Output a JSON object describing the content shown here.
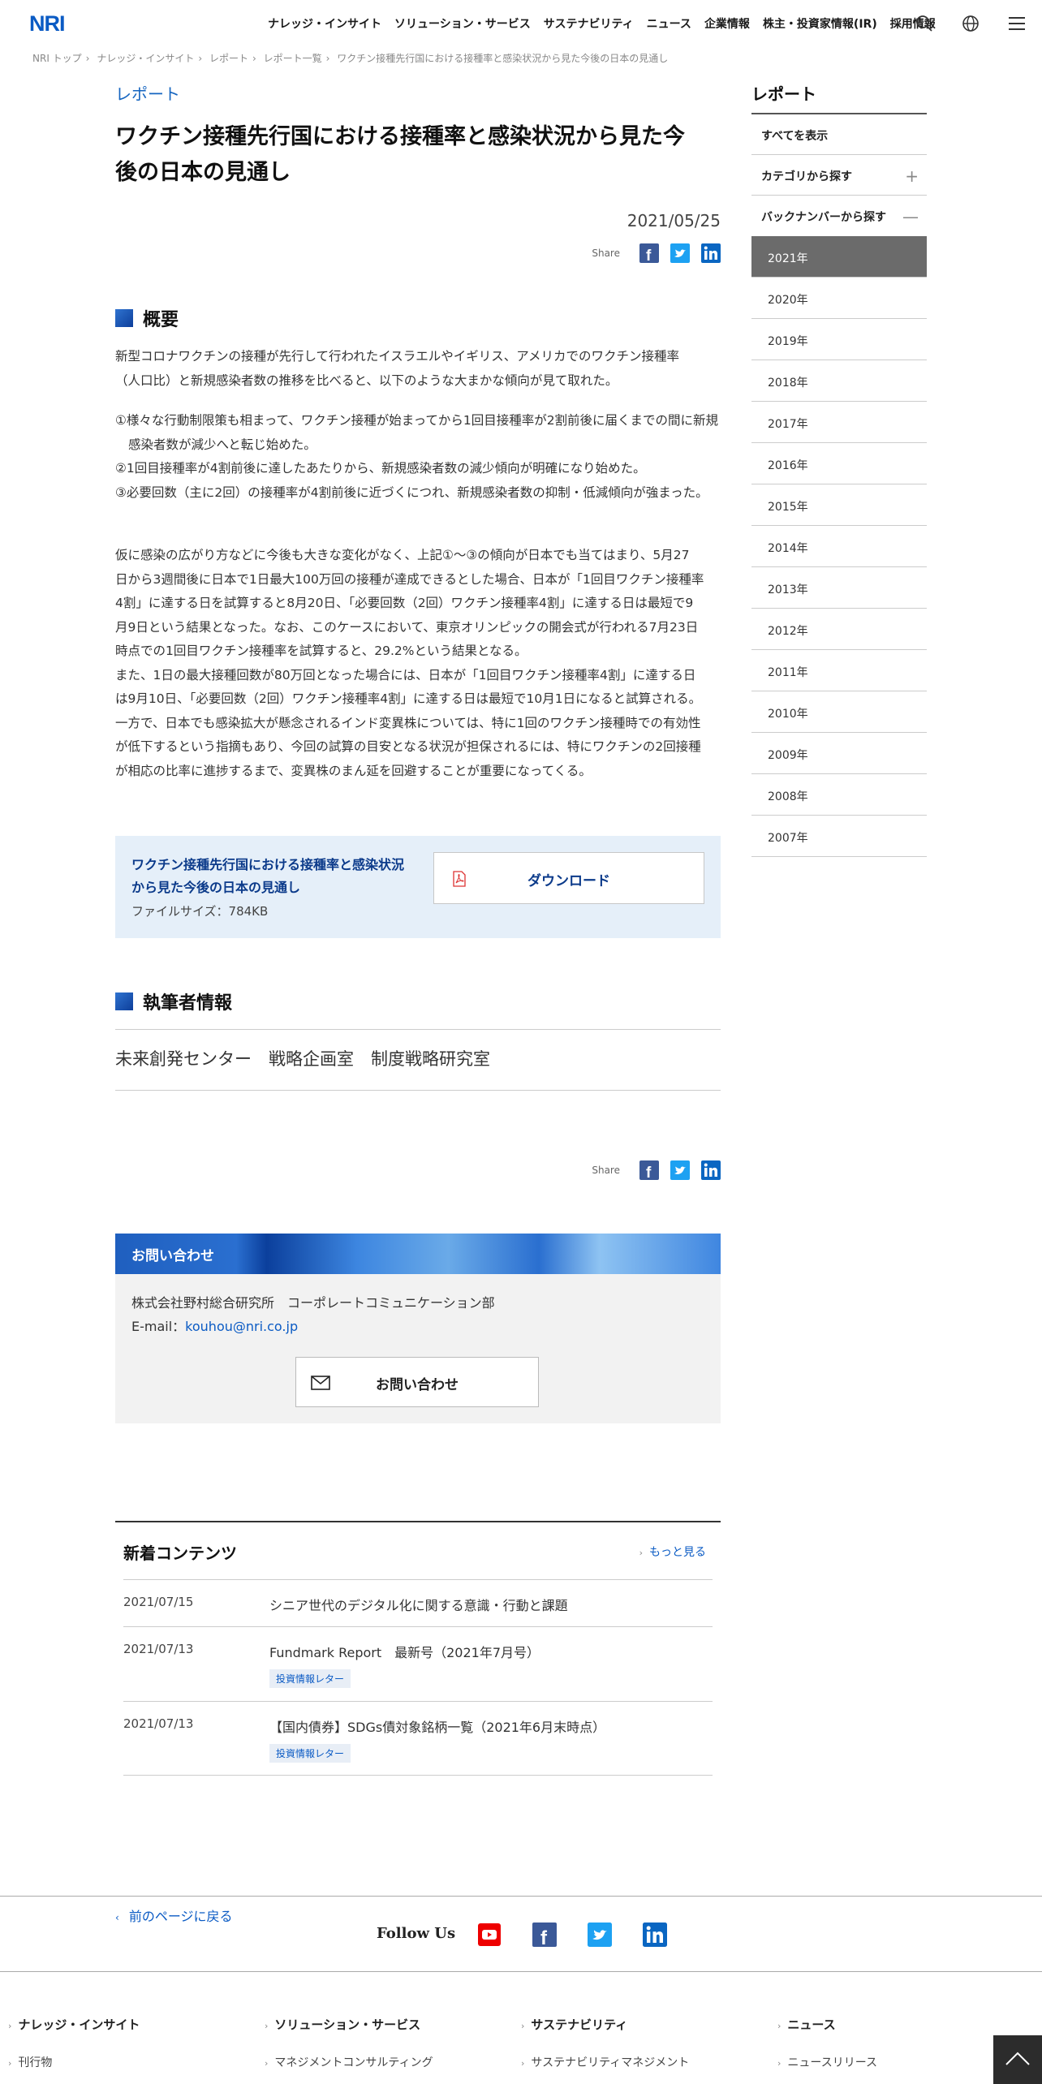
{
  "header": {
    "logo": "NRI",
    "nav": [
      "ナレッジ・インサイト",
      "ソリューション・サービス",
      "サステナビリティ",
      "ニュース",
      "企業情報",
      "株主・投資家情報(IR)",
      "採用情報"
    ]
  },
  "breadcrumb": [
    "NRI トップ",
    "ナレッジ・インサイト",
    "レポート",
    "レポート一覧",
    "ワクチン接種先行国における接種率と感染状況から見た今後の日本の見通し"
  ],
  "article": {
    "category": "レポート",
    "title_line1": "ワクチン接種先行国における接種率と感染状況から見た今",
    "title_line2": "後の日本の見通し",
    "date": "2021/05/25",
    "share_label": "Share",
    "overview_heading": "概要",
    "intro_line1": "新型コロナワクチンの接種が先行して行われたイスラエルやイギリス、アメリカでのワクチン接種率",
    "intro_line2": "（人口比）と新規感染者数の推移を比べると、以下のような大まかな傾向が見て取れた。",
    "points": [
      "①様々な行動制限策も相まって、ワクチン接種が始まってから1回目接種率が2割前後に届くまでの間に新規感染者数が減少へと転じ始めた。",
      "②1回目接種率が4割前後に達したあたりから、新規感染者数の減少傾向が明確になり始めた。",
      "③必要回数（主に2回）の接種率が4割前後に近づくにつれ、新規感染者数の抑制・低減傾向が強まった。"
    ],
    "paragraph_lines": [
      "仮に感染の広がり方などに今後も大きな変化がなく、上記①〜③の傾向が日本でも当てはまり、5月27",
      "日から3週間後に日本で1日最大100万回の接種が達成できるとした場合、日本が「1回目ワクチン接種率",
      "4割」に達する日を試算すると8月20日、「必要回数（2回）ワクチン接種率4割」に達する日は最短で9",
      "月9日という結果となった。なお、このケースにおいて、東京オリンピックの開会式が行われる7月23日",
      "時点での1回目ワクチン接種率を試算すると、29.2%という結果となる。",
      "また、1日の最大接種回数が80万回となった場合には、日本が「1回目ワクチン接種率4割」に達する日",
      "は9月10日、「必要回数（2回）ワクチン接種率4割」に達する日は最短で10月1日になると試算される。",
      "一方で、日本でも感染拡大が懸念されるインド変異株については、特に1回のワクチン接種時での有効性",
      "が低下するという指摘もあり、今回の試算の目安となる状況が担保されるには、特にワクチンの2回接種",
      "が相応の比率に進捗するまで、変異株のまん延を回避することが重要になってくる。"
    ]
  },
  "download": {
    "title_line1": "ワクチン接種先行国における接種率と感染状況",
    "title_line2": "から見た今後の日本の見通し",
    "size": "ファイルサイズ：784KB",
    "button": "ダウンロード"
  },
  "author": {
    "heading": "執筆者情報",
    "name": "未来創発センター　戦略企画室　制度戦略研究室"
  },
  "contact": {
    "heading": "お問い合わせ",
    "org": "株式会社野村総合研究所　コーポレートコミュニケーション部",
    "email_label": "E-mail：",
    "email": "kouhou@nri.co.jp",
    "button": "お問い合わせ"
  },
  "news": {
    "heading": "新着コンテンツ",
    "more": "もっと見る",
    "items": [
      {
        "date": "2021/07/15",
        "title": "シニア世代のデジタル化に関する意識・行動と課題",
        "tag": ""
      },
      {
        "date": "2021/07/13",
        "title": "Fundmark Report　最新号（2021年7月号）",
        "tag": "投資情報レター"
      },
      {
        "date": "2021/07/13",
        "title": "【国内債券】SDGs債対象銘柄一覧（2021年6月末時点）",
        "tag": "投資情報レター"
      }
    ]
  },
  "back": "前のページに戻る",
  "sidebar": {
    "title": "レポート",
    "all": "すべてを表示",
    "category": "カテゴリから探す",
    "backnumber": "バックナンバーから探す",
    "years": [
      "2021年",
      "2020年",
      "2019年",
      "2018年",
      "2017年",
      "2016年",
      "2015年",
      "2014年",
      "2013年",
      "2012年",
      "2011年",
      "2010年",
      "2009年",
      "2008年",
      "2007年"
    ]
  },
  "follow": {
    "label": "Follow Us"
  },
  "footer": {
    "cols": [
      {
        "heading": "ナレッジ・インサイト",
        "sub": "刊行物"
      },
      {
        "heading": "ソリューション・サービス",
        "sub": "マネジメントコンサルティング"
      },
      {
        "heading": "サステナビリティ",
        "sub": "サステナビリティマネジメント"
      },
      {
        "heading": "ニュース",
        "sub": "ニュースリリース"
      }
    ]
  },
  "colors": {
    "brand": "#0b3a8a",
    "link": "#0b5bc4",
    "active_year_bg": "#6b6b6b",
    "download_bg": "#e5eff9"
  }
}
